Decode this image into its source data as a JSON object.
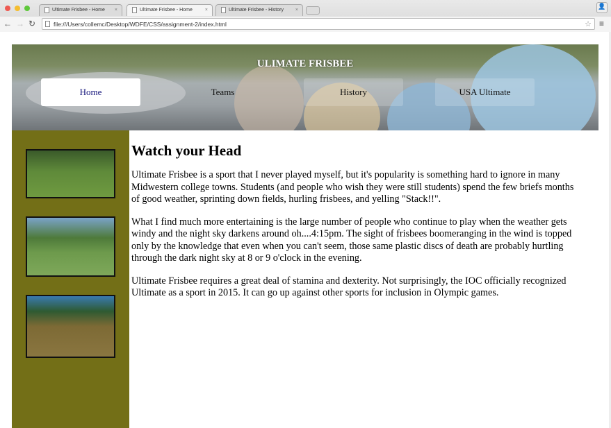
{
  "browser": {
    "tabs": [
      {
        "label": "Ultimate Frisbee - Home"
      },
      {
        "label": "Ultimate Frisbee - Home"
      },
      {
        "label": "Ultimate Frisbee - History"
      }
    ],
    "active_tab": 1,
    "url": "file:///Users/collemc/Desktop/WDFE/CSS/assignment-2/index.html"
  },
  "header": {
    "title": "ULIMATE FRISBEE",
    "nav": [
      {
        "label": "Home",
        "active": true
      },
      {
        "label": "Teams"
      },
      {
        "label": "History"
      },
      {
        "label": "USA Ultimate"
      }
    ]
  },
  "main": {
    "heading": "Watch your Head",
    "paragraphs": [
      "Ultimate Frisbee is a sport that I never played myself, but it's popularity is something hard to ignore in many Midwestern college towns. Students (and people who wish they were still students) spend the few briefs months of good weather, sprinting down fields, hurling frisbees, and yelling \"Stack!!\".",
      "What I find much more entertaining is the large number of people who continue to play when the weather gets windy and the night sky darkens around oh....4:15pm. The sight of frisbees boomeranging in the wind is topped only by the knowledge that even when you can't seem, those same plastic discs of death are probably hurtling through the dark night sky at 8 or 9 o'clock in the evening.",
      "Ultimate Frisbee requires a great deal of stamina and dexterity. Not surprisingly, the IOC officially recognized Ultimate as a sport in 2015. It can go up against other sports for inclusion in Olympic games."
    ]
  },
  "colors": {
    "sidebar": "#736f17",
    "active_nav_text": "#12127a"
  }
}
